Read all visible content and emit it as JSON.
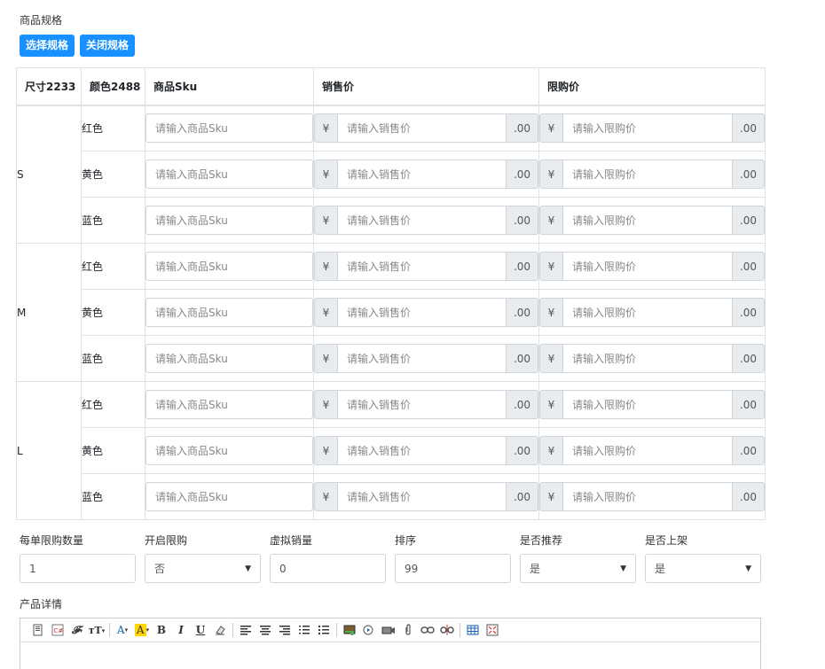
{
  "spec_section_label": "商品规格",
  "buttons": {
    "select_spec": "选择规格",
    "close_spec": "关闭规格"
  },
  "table": {
    "headers": [
      "尺寸2233",
      "颜色2488",
      "商品Sku",
      "销售价",
      "限购价"
    ],
    "groups": [
      {
        "size": "S",
        "colors": [
          "红色",
          "黄色",
          "蓝色"
        ]
      },
      {
        "size": "M",
        "colors": [
          "红色",
          "黄色",
          "蓝色"
        ]
      },
      {
        "size": "L",
        "colors": [
          "红色",
          "黄色",
          "蓝色"
        ]
      }
    ],
    "sku_placeholder": "请输入商品Sku",
    "sale_price_placeholder": "请输入销售价",
    "limit_price_placeholder": "请输入限购价",
    "currency_prefix": "¥",
    "decimal_suffix": ".00"
  },
  "fields": [
    {
      "label": "每单限购数量",
      "value": "1",
      "type": "input"
    },
    {
      "label": "开启限购",
      "value": "否",
      "type": "select"
    },
    {
      "label": "虚拟销量",
      "value": "0",
      "type": "input"
    },
    {
      "label": "排序",
      "value": "99",
      "type": "input"
    },
    {
      "label": "是否推荐",
      "value": "是",
      "type": "select"
    },
    {
      "label": "是否上架",
      "value": "是",
      "type": "select"
    }
  ],
  "detail_label": "产品详情",
  "toolbar_icons": [
    "source-icon",
    "code-icon",
    "font-family-icon",
    "font-size-icon",
    "font-color-icon",
    "highlight-icon",
    "bold-icon",
    "italic-icon",
    "underline-icon",
    "eraser-icon",
    "align-left-icon",
    "align-center-icon",
    "align-right-icon",
    "ordered-list-icon",
    "unordered-list-icon",
    "image-icon",
    "media-icon",
    "video-icon",
    "attachment-icon",
    "link-icon",
    "unlink-icon",
    "table-icon",
    "fullscreen-icon"
  ]
}
